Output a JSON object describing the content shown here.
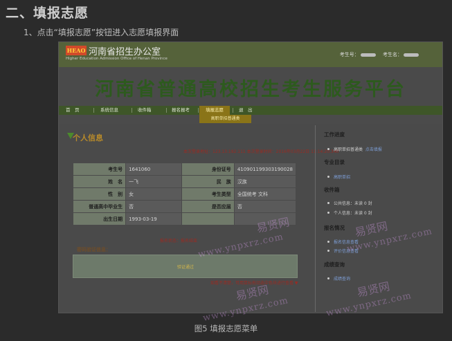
{
  "doc": {
    "heading": "二、填报志愿",
    "step": "1、点击“填报志愿”按钮进入志愿填报界面",
    "caption": "图5 填报志愿菜单"
  },
  "site": {
    "logo_badge": "HEAO",
    "logo_name": "河南省招生办公室",
    "logo_sub": "Higher Education Admission Office of Henan Province",
    "user_id_label": "考生号：",
    "user_name_label": "考生名："
  },
  "banner": {
    "title": "河南省普通高校招生考生服务平台"
  },
  "nav": {
    "items": [
      "首　页",
      "系统信息",
      "收件箱",
      "报名报考",
      "填报志愿",
      "退　出"
    ],
    "active_index": 4,
    "submenu": "高职单招普通类"
  },
  "profile": {
    "title": "个人信息",
    "login_line": "本次登录地址：123.13.192.111  本次登录时间：2016年03月22日 11:14:20.340",
    "rows": [
      {
        "k1": "考生号",
        "v1": "1641060",
        "k2": "身份证号",
        "v2": "410901199303190028"
      },
      {
        "k1": "姓　名",
        "v1": "一飞",
        "k2": "民　族",
        "v2": "汉族"
      },
      {
        "k1": "性　别",
        "v1": "女",
        "k2": "考生类型",
        "v2": "全国统考  文科"
      },
      {
        "k1": "普通高中毕业生",
        "v1": "否",
        "k2": "是否应届",
        "v2": "否"
      },
      {
        "k1": "出生日期",
        "v1": "1993-03-19",
        "k2": "",
        "v2": ""
      }
    ],
    "status": "报名状态：报名结束",
    "password_label": "密码验证信息：",
    "password_tag": "验证通过",
    "hint": "如看不清楚，可用鼠标拖动选中色块进行查看 ▼"
  },
  "sidebar": {
    "sections": [
      {
        "title": "工作进度",
        "items": [
          {
            "text": "高职单招普通类",
            "link": "点击填报"
          }
        ]
      },
      {
        "title": "专业目录",
        "items": [
          {
            "text": "高职单招",
            "link": ""
          }
        ]
      },
      {
        "title": "收件箱",
        "items": [
          {
            "text": "公共信息：未读  0  封",
            "link": ""
          },
          {
            "text": "个人信息：未读  0  封",
            "link": ""
          }
        ]
      },
      {
        "title": "报名情况",
        "items": [
          {
            "text": "报名信息查看",
            "link": ""
          },
          {
            "text": "评价信息查看",
            "link": ""
          }
        ]
      },
      {
        "title": "成绩查询",
        "items": [
          {
            "text": "成绩查询",
            "link": ""
          }
        ]
      }
    ]
  },
  "watermarks": {
    "cn": "易贤网",
    "en": "www.ynpxrz.com"
  }
}
